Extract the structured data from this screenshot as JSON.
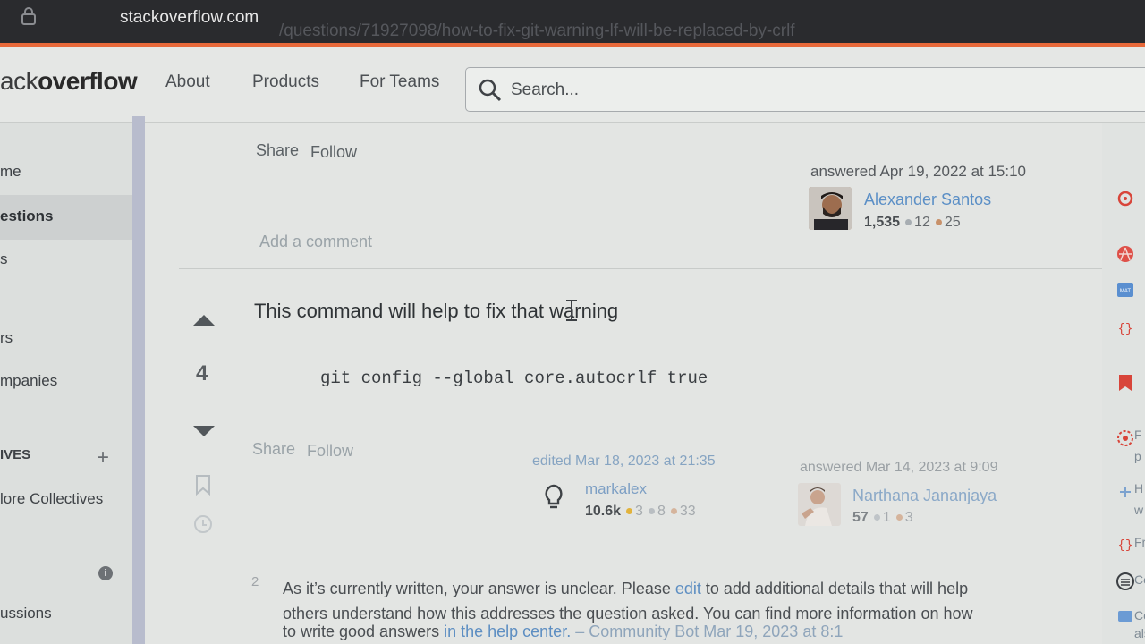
{
  "browser": {
    "host": "stackoverflow.com",
    "path": "/questions/71927098/how-to-fix-git-warning-lf-will-be-replaced-by-crlf"
  },
  "header": {
    "logo_light": "ack",
    "logo_bold": "overflow",
    "nav": [
      "About",
      "Products",
      "For Teams"
    ],
    "search_placeholder": "Search..."
  },
  "sidebar": {
    "items": [
      "me",
      "estions",
      "s",
      "rs",
      "mpanies",
      "IVES",
      "lore Collectives",
      "ussions"
    ],
    "plus": "+",
    "info": "i"
  },
  "answer1": {
    "share": "Share",
    "follow": "Follow",
    "answered": "answered Apr 19, 2022 at 15:10",
    "user": "Alexander Santos",
    "rep": "1,535",
    "silver": "12",
    "bronze": "25",
    "add_comment": "Add a comment"
  },
  "answer2": {
    "text": "This command will help to fix that warning",
    "vote_count": "4",
    "code": "git config --global core.autocrlf true",
    "share": "Share",
    "follow": "Follow",
    "edited": "edited Mar 18, 2023 at 21:35",
    "editor": "markalex",
    "editor_rep": "10.6k",
    "editor_gold": "3",
    "editor_silver": "8",
    "editor_bronze": "33",
    "answered": "answered Mar 14, 2023 at 9:09",
    "user": "Narthana Jananjaya",
    "user_rep": "57",
    "user_silver": "1",
    "user_bronze": "3"
  },
  "comment": {
    "score": "2",
    "line1_a": "As it’s currently written, your answer is unclear. Please ",
    "line1_link": "edit",
    "line1_b": " to add additional details that will help",
    "line2": "others understand how this addresses the question asked. You can find more information on how",
    "line3_a": "to write good answers ",
    "line3_link": "in the help center.",
    "line3_b": " – Community Bot  Mar 19, 2023 at 8:1"
  },
  "right_rail": {
    "labels": [
      "F",
      "p",
      "H",
      "w",
      "Fr",
      "Co",
      "Co",
      "als"
    ]
  },
  "colors": {
    "accent_orange": "#e8693a",
    "link_blue": "#5d8ec2",
    "gold_badge": "#e2b33c",
    "silver_badge": "#a7adb2",
    "bronze_badge": "#c8916a"
  }
}
